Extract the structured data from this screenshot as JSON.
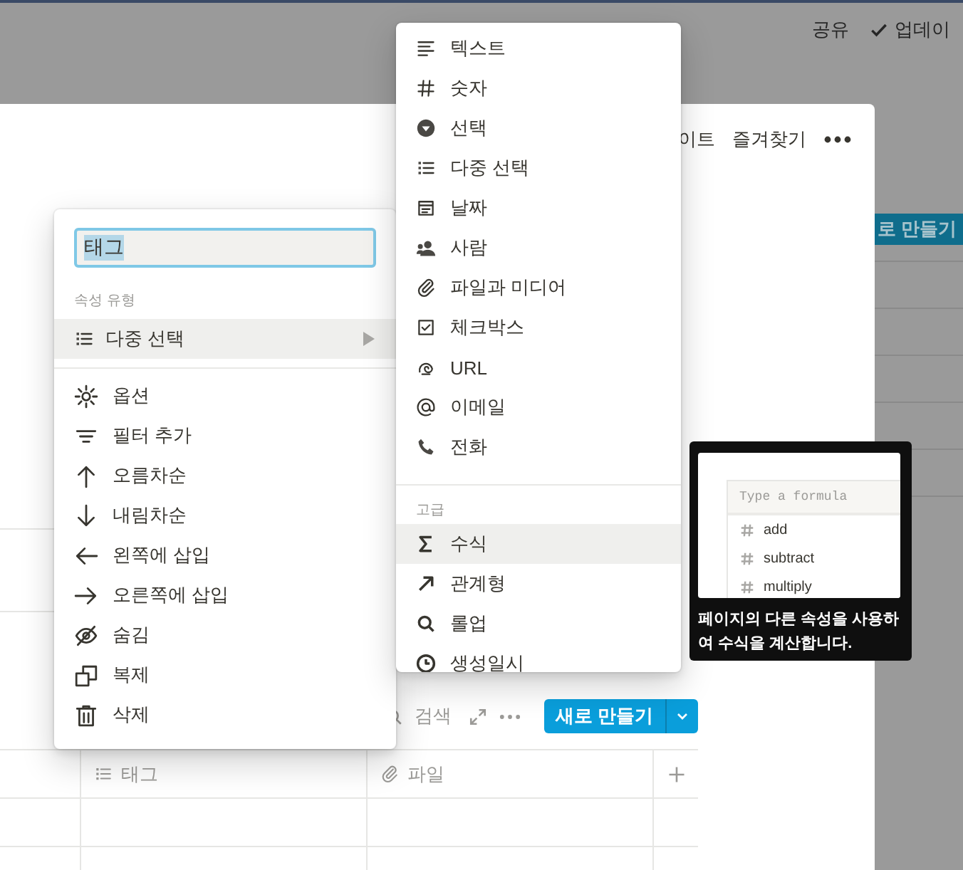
{
  "background_app": {
    "share": "공유",
    "update": "업데이",
    "new_button": "로 만들기"
  },
  "page": {
    "top_actions": [
      "이트",
      "즐겨찾기"
    ],
    "toolbar": {
      "search": "검색",
      "new_button": "새로 만들기"
    },
    "table": {
      "columns": [
        {
          "kind": "multi_select",
          "label": "태그"
        },
        {
          "kind": "file",
          "label": "파일"
        }
      ]
    }
  },
  "property_menu": {
    "name_value": "태그",
    "section_label": "속성 유형",
    "type_row": {
      "kind": "multi_select",
      "label": "다중 선택",
      "selected": true
    },
    "items": [
      {
        "kind": "options",
        "label": "옵션"
      },
      {
        "kind": "filter",
        "label": "필터 추가"
      },
      {
        "kind": "sort_ascending",
        "label": "오름차순"
      },
      {
        "kind": "sort_descending",
        "label": "내림차순"
      },
      {
        "kind": "insert_left",
        "label": "왼쪽에 삽입"
      },
      {
        "kind": "insert_right",
        "label": "오른쪽에 삽입"
      },
      {
        "kind": "hide",
        "label": "숨김"
      },
      {
        "kind": "duplicate",
        "label": "복제"
      },
      {
        "kind": "delete",
        "label": "삭제"
      }
    ]
  },
  "type_menu": {
    "items": [
      {
        "kind": "text",
        "label": "텍스트",
        "selected": false
      },
      {
        "kind": "number",
        "label": "숫자",
        "selected": false
      },
      {
        "kind": "select",
        "label": "선택",
        "selected": false
      },
      {
        "kind": "multi_select",
        "label": "다중 선택",
        "selected": false
      },
      {
        "kind": "date",
        "label": "날짜",
        "selected": false
      },
      {
        "kind": "person",
        "label": "사람",
        "selected": false
      },
      {
        "kind": "file",
        "label": "파일과 미디어",
        "selected": false
      },
      {
        "kind": "checkbox",
        "label": "체크박스",
        "selected": false
      },
      {
        "kind": "url",
        "label": "URL",
        "selected": false
      },
      {
        "kind": "email",
        "label": "이메일",
        "selected": false
      },
      {
        "kind": "phone",
        "label": "전화",
        "selected": false
      }
    ],
    "advanced_label": "고급",
    "advanced_items": [
      {
        "kind": "formula",
        "label": "수식",
        "selected": true
      },
      {
        "kind": "relation",
        "label": "관계형",
        "selected": false
      },
      {
        "kind": "rollup",
        "label": "롤업",
        "selected": false
      },
      {
        "kind": "created_time",
        "label": "생성일시",
        "selected": false
      }
    ]
  },
  "tooltip": {
    "formula_placeholder": "Type a formula",
    "functions": [
      "add",
      "subtract",
      "multiply"
    ],
    "description": "페이지의 다른 속성을 사용하여 수식을 계산합니다."
  }
}
